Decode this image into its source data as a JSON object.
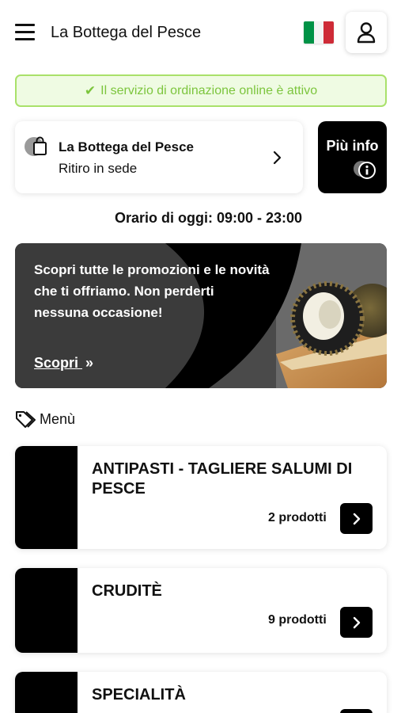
{
  "header": {
    "title": "La Bottega del Pesce",
    "menu_icon": "hamburger-icon",
    "language_flag": "italy-flag",
    "user_icon": "user-icon"
  },
  "status": {
    "text": "Il servizio di ordinazione online è attivo",
    "icon": "check-icon",
    "color": "#7cc53d"
  },
  "store": {
    "name": "La Bottega del Pesce",
    "mode": "Ritiro in sede",
    "icon": "shopping-bag-icon"
  },
  "info_button": {
    "label": "Più info",
    "icon": "info-icon"
  },
  "hours": {
    "text": "Orario di oggi: 09:00 - 23:00"
  },
  "promo": {
    "text": "Scopri tutte le promozioni e le novità che ti offriamo. Non perderti nessuna occasione!",
    "link_label": "Scopri",
    "link_icon": "double-chevron-right-icon"
  },
  "menu": {
    "heading": "Menù",
    "icon": "tag-icon",
    "categories": [
      {
        "title": "ANTIPASTI - TAGLIERE SALUMI DI PESCE",
        "count": "2 prodotti"
      },
      {
        "title": "CRUDITÈ",
        "count": "9 prodotti"
      },
      {
        "title": "SPECIALITÀ",
        "count": ""
      }
    ]
  },
  "colors": {
    "accent_green": "#7cc53d",
    "banner_border": "#a9e16a",
    "banner_bg": "#effbe3",
    "flag_green": "#009246",
    "flag_red": "#ce2b37"
  }
}
